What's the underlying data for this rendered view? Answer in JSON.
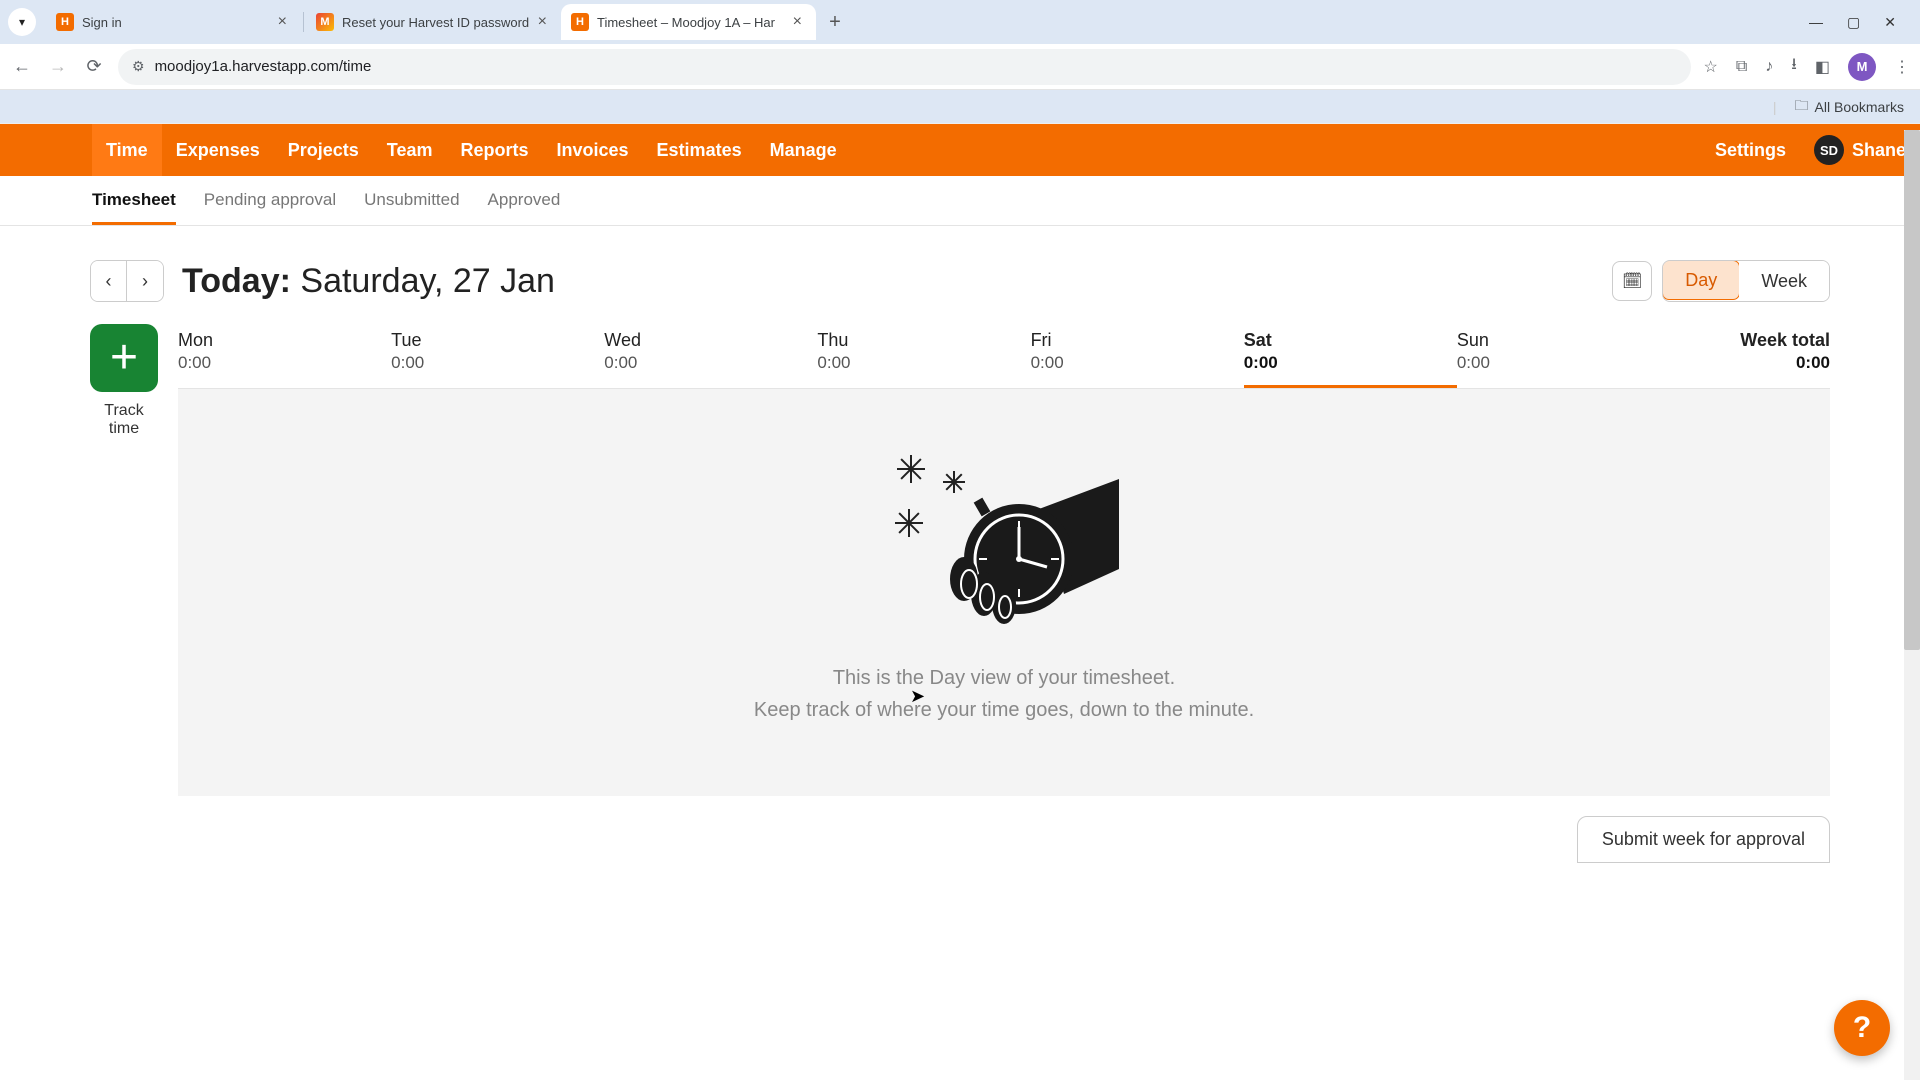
{
  "browser": {
    "tabs": [
      {
        "title": "Sign in",
        "favicon": "fav-orange"
      },
      {
        "title": "Reset your Harvest ID password",
        "favicon": "fav-gmail"
      },
      {
        "title": "Timesheet – Moodjoy 1A – Har",
        "favicon": "fav-orange",
        "active": true
      }
    ],
    "url": "moodjoy1a.harvestapp.com/time",
    "bookmarks_label": "All Bookmarks",
    "profile_initial": "M"
  },
  "nav": {
    "items": [
      "Time",
      "Expenses",
      "Projects",
      "Team",
      "Reports",
      "Invoices",
      "Estimates",
      "Manage"
    ],
    "active": "Time",
    "settings": "Settings",
    "user_initials": "SD",
    "user_name": "Shane"
  },
  "subnav": {
    "items": [
      "Timesheet",
      "Pending approval",
      "Unsubmitted",
      "Approved"
    ],
    "active": "Timesheet"
  },
  "date": {
    "prefix": "Today:",
    "value": "Saturday, 27 Jan"
  },
  "view_toggle": {
    "day": "Day",
    "week": "Week",
    "active": "Day"
  },
  "track": {
    "label": "Track time",
    "plus": "+"
  },
  "days": [
    {
      "name": "Mon",
      "value": "0:00"
    },
    {
      "name": "Tue",
      "value": "0:00"
    },
    {
      "name": "Wed",
      "value": "0:00"
    },
    {
      "name": "Thu",
      "value": "0:00"
    },
    {
      "name": "Fri",
      "value": "0:00"
    },
    {
      "name": "Sat",
      "value": "0:00",
      "active": true
    },
    {
      "name": "Sun",
      "value": "0:00"
    }
  ],
  "week_total": {
    "label": "Week total",
    "value": "0:00"
  },
  "empty": {
    "line1": "This is the Day view of your timesheet.",
    "line2": "Keep track of where your time goes, down to the minute."
  },
  "submit_label": "Submit week for approval",
  "help": "?"
}
